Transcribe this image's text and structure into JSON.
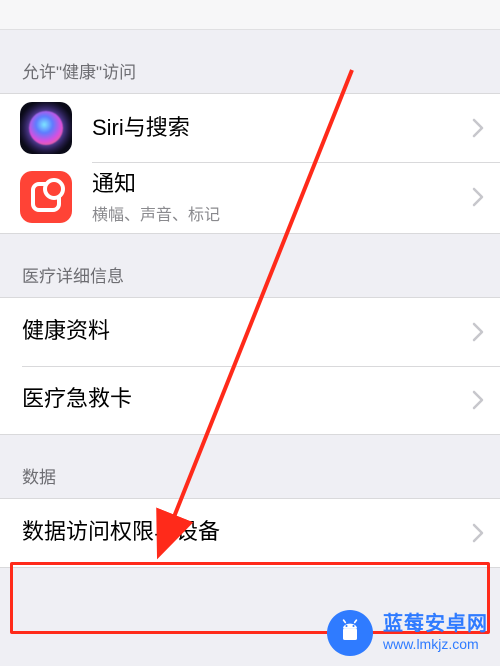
{
  "sections": {
    "allow_access_header": "允许\"健康\"访问",
    "medical_header": "医疗详细信息",
    "data_header": "数据"
  },
  "rows": {
    "siri": {
      "title": "Siri与搜索"
    },
    "notif": {
      "title": "通知",
      "subtitle": "横幅、声音、标记"
    },
    "profile": {
      "title": "健康资料"
    },
    "medid": {
      "title": "医疗急救卡"
    },
    "access": {
      "title": "数据访问权限与设备"
    }
  },
  "watermark": {
    "title": "蓝莓安卓网",
    "url": "www.lmkjz.com"
  },
  "annotation": {
    "highlight_color": "#ff2a1a"
  }
}
